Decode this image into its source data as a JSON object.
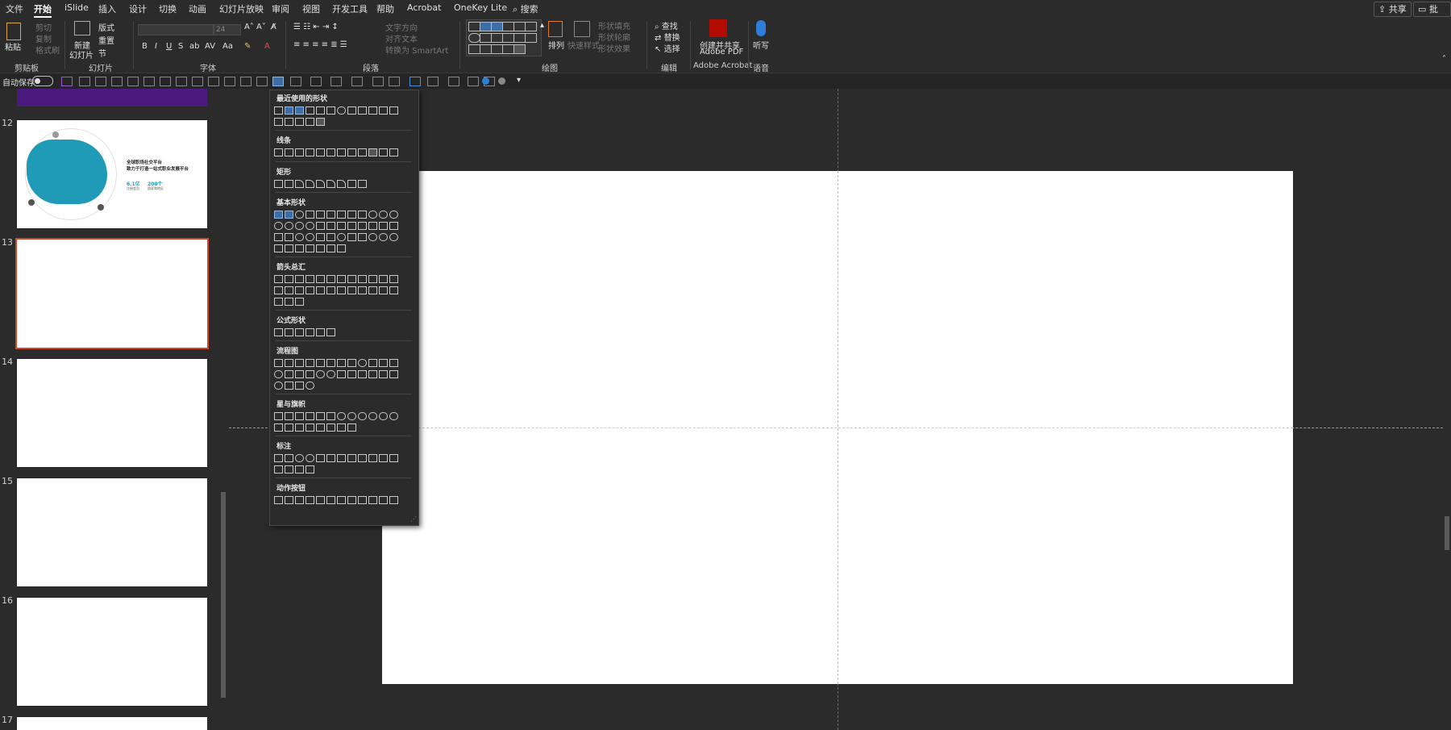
{
  "menu": {
    "tabs": [
      "文件",
      "开始",
      "iSlide",
      "插入",
      "设计",
      "切换",
      "动画",
      "幻灯片放映",
      "审阅",
      "视图",
      "开发工具",
      "帮助",
      "Acrobat",
      "OneKey Lite"
    ],
    "active_tab": "开始",
    "search_label": "搜索",
    "share_label": "共享",
    "comments_label": "批注"
  },
  "ribbon": {
    "clipboard": {
      "paste": "粘贴",
      "cut": "剪切",
      "copy": "复制",
      "format_painter": "格式刷",
      "group": "剪贴板"
    },
    "slides": {
      "new_slide_1": "新建",
      "new_slide_2": "幻灯片",
      "layout": "版式",
      "reset": "重置",
      "section": "节",
      "group": "幻灯片"
    },
    "font": {
      "size": "24",
      "group": "字体"
    },
    "paragraph": {
      "text_direction": "文字方向",
      "align_text": "对齐文本",
      "smartart": "转换为 SmartArt",
      "group": "段落"
    },
    "drawing": {
      "arrange": "排列",
      "quick_styles": "快速样式",
      "fill": "形状填充",
      "outline": "形状轮廓",
      "effects": "形状效果",
      "group": "绘图"
    },
    "editing": {
      "find": "查找",
      "replace": "替换",
      "select": "选择",
      "group": "编辑"
    },
    "acrobat": {
      "create_1": "创建并共享",
      "create_2": "Adobe PDF",
      "group": "Adobe Acrobat"
    },
    "voice": {
      "dictate": "听写",
      "group": "语音"
    }
  },
  "qat": {
    "autosave": "自动保存",
    "toggle_state": "关"
  },
  "thumbnails": [
    {
      "num": "12",
      "title_1": "全球职场社交平台",
      "title_2": "致力于打造一站式职业发展平台",
      "stat_1": "6.1亿",
      "stat_1_label": "注册会员",
      "stat_2": "200个",
      "stat_2_label": "国家和地区"
    },
    {
      "num": "13"
    },
    {
      "num": "14"
    },
    {
      "num": "15"
    },
    {
      "num": "16"
    },
    {
      "num": "17"
    }
  ],
  "shapes_panel": {
    "sections": [
      "最近使用的形状",
      "线条",
      "矩形",
      "基本形状",
      "箭头总汇",
      "公式形状",
      "流程图",
      "星与旗帜",
      "标注",
      "动作按钮"
    ]
  },
  "colors": {
    "accent": "#d24726",
    "teal": "#1f9bb8",
    "background": "#2b2b2b",
    "purple": "#4b1a7e"
  }
}
